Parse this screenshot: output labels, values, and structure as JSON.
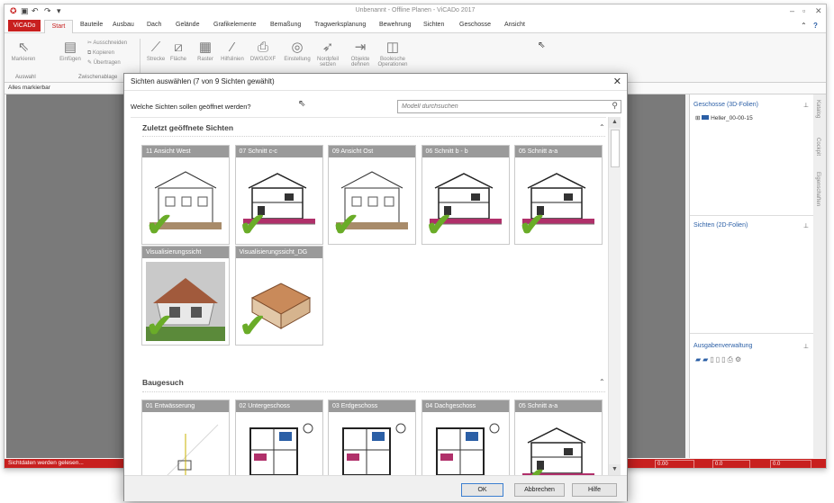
{
  "app": {
    "title": "Unbenannt - Offline Planen - ViCADo 2017",
    "menu_tab": "ViCADo",
    "tabs": [
      "Start",
      "Bauteile",
      "Ausbau",
      "Dach",
      "Gelände",
      "Grafikelemente",
      "Bemaßung",
      "Tragwerksplanung",
      "Bewehrung",
      "Sichten",
      "Geschosse",
      "Ansicht"
    ],
    "ribbon": {
      "markieren": "Markieren",
      "einfuegen": "Einfügen",
      "ausschneiden": "Ausschneiden",
      "kopieren": "Kopieren",
      "uebertragen": "Übertragen",
      "strecke": "Strecke",
      "flaeche": "Fläche",
      "raster": "Raster",
      "hilfslinien": "Hilfslinien",
      "dwg_dxf": "DWG/DXF",
      "einstellung": "Einstellung",
      "nordpfeil": "Nordpfeil setzen",
      "objekte_dehnen": "Objekte dehnen",
      "boolesche": "Boolesche Operationen",
      "group_auswahl": "Auswahl",
      "group_zwischenablage": "Zwischenablage"
    },
    "filter": "Alles markierbar",
    "right_panel": {
      "geschosse_title": "Geschosse (3D-Folien)",
      "geschosse_item": "Heller_00-00-15",
      "sichten_title": "Sichten (2D-Folien)",
      "ausgabe_title": "Ausgabenverwaltung"
    },
    "side_tabs": [
      "Katalog",
      "Cockpit",
      "Eigenschaften"
    ],
    "status": "Sichtdaten werden gelesen...",
    "status_fields": [
      "0.00",
      "0.0",
      "0.0"
    ]
  },
  "dialog": {
    "title": "Sichten auswählen (7 von 9 Sichten gewählt)",
    "question": "Welche Sichten sollen geöffnet werden?",
    "search_placeholder": "Modell durchsuchen",
    "section_recent": "Zuletzt geöffnete Sichten",
    "section_baugesuch": "Baugesuch",
    "recent_cards": [
      {
        "label": "11 Ansicht West",
        "checked": true,
        "kind": "elevation"
      },
      {
        "label": "07 Schnitt c-c",
        "checked": true,
        "kind": "section"
      },
      {
        "label": "09 Ansicht Ost",
        "checked": true,
        "kind": "elevation"
      },
      {
        "label": "06 Schnitt b - b",
        "checked": true,
        "kind": "section"
      },
      {
        "label": "05 Schnitt a-a",
        "checked": true,
        "kind": "section"
      },
      {
        "label": "Visualisierungssicht",
        "checked": true,
        "kind": "render"
      },
      {
        "label": "Visualisierungssicht_DG",
        "checked": true,
        "kind": "render2"
      }
    ],
    "baugesuch_cards": [
      {
        "label": "01 Entwässerung",
        "checked": false,
        "kind": "site"
      },
      {
        "label": "02 Untergeschoss",
        "checked": false,
        "kind": "plan"
      },
      {
        "label": "03 Erdgeschoss",
        "checked": false,
        "kind": "plan"
      },
      {
        "label": "04 Dachgeschoss",
        "checked": false,
        "kind": "plan"
      },
      {
        "label": "05 Schnitt a-a",
        "checked": true,
        "kind": "section"
      }
    ],
    "buttons": {
      "ok": "OK",
      "cancel": "Abbrechen",
      "help": "Hilfe"
    },
    "colors": {
      "check": "#6aac28",
      "card_caption": "#9a9a9a",
      "accent": "#c8201f"
    }
  }
}
